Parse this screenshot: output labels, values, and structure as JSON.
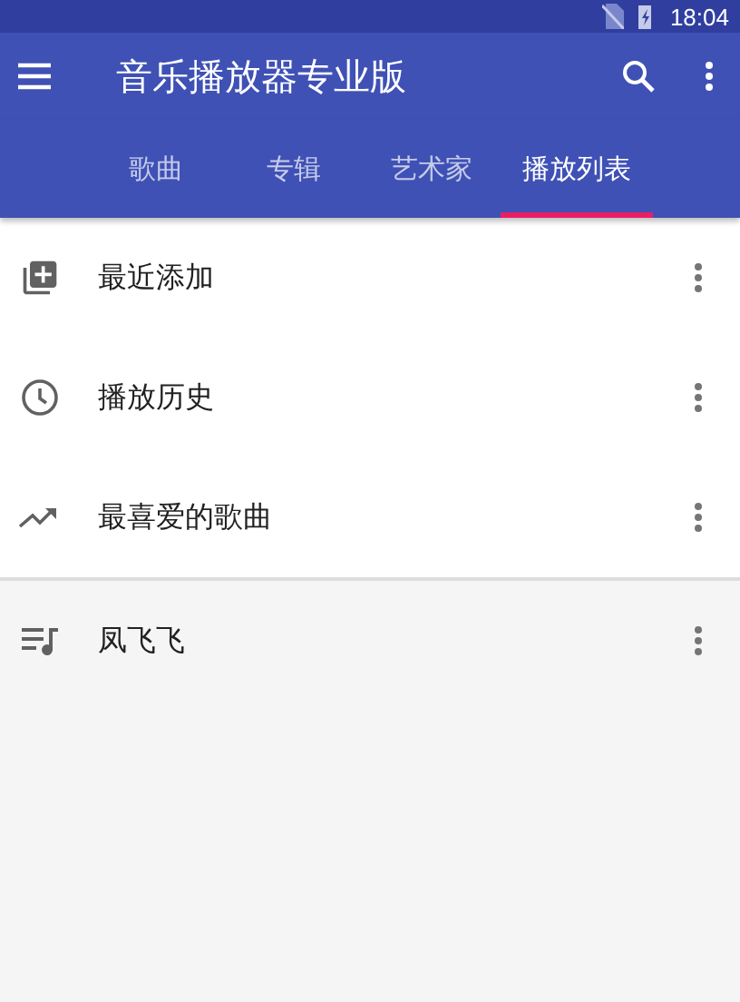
{
  "status_bar": {
    "time": "18:04"
  },
  "toolbar": {
    "title": "音乐播放器专业版"
  },
  "tabs": [
    {
      "label": "歌曲",
      "selected": false
    },
    {
      "label": "专辑",
      "selected": false
    },
    {
      "label": "艺术家",
      "selected": false
    },
    {
      "label": "播放列表",
      "selected": true
    }
  ],
  "smart_playlists": [
    {
      "kind": "recent",
      "name": "最近添加"
    },
    {
      "kind": "history",
      "name": "播放历史"
    },
    {
      "kind": "favorites",
      "name": "最喜爱的歌曲"
    }
  ],
  "user_playlists": [
    {
      "kind": "playlist",
      "name": "凤飞飞"
    }
  ]
}
